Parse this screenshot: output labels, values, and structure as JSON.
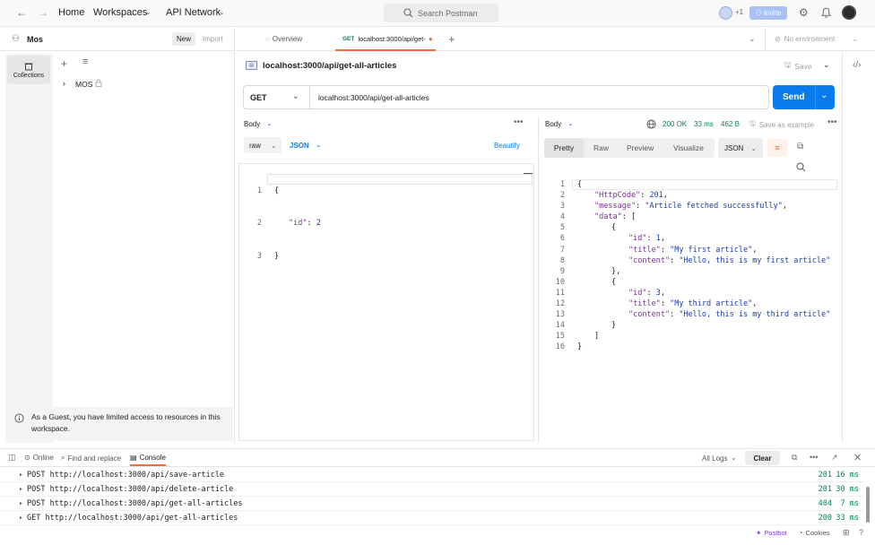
{
  "topbar": {
    "home": "Home",
    "workspaces": "Workspaces",
    "api_network": "API Network",
    "search_placeholder": "Search Postman",
    "plus_count": "+1",
    "invite": "Invite"
  },
  "sidebar": {
    "workspace": "Mos",
    "new": "New",
    "import": "Import",
    "collections": "Collections",
    "collection_name": "MOS",
    "guest_note": "As a Guest, you have limited access to resources in this workspace."
  },
  "tabs": {
    "overview": "Overview",
    "active_method": "GET",
    "active_label": "localhost:3000/api/get-",
    "environment": "No environment"
  },
  "request": {
    "title": "localhost:3000/api/get-all-articles",
    "save": "Save",
    "method": "GET",
    "url": "localhost:3000/api/get-all-articles",
    "send": "Send",
    "body_label": "Body",
    "raw": "raw",
    "json": "JSON",
    "beautify": "Beautify",
    "body_lines": [
      {
        "n": "1",
        "text": "{"
      },
      {
        "n": "2",
        "key": "\"id\"",
        "value": "2"
      },
      {
        "n": "3",
        "text": "}"
      }
    ]
  },
  "response": {
    "body_label": "Body",
    "status": "200 OK",
    "time": "33 ms",
    "size": "462 B",
    "save_example": "Save as example",
    "tabs": [
      "Pretty",
      "Raw",
      "Preview",
      "Visualize"
    ],
    "format": "JSON",
    "lines": [
      {
        "n": "1",
        "indent": 0,
        "p": "{"
      },
      {
        "n": "2",
        "indent": 1,
        "k": "\"HttpCode\"",
        "p": ": ",
        "v": "201",
        "e": ","
      },
      {
        "n": "3",
        "indent": 1,
        "k": "\"message\"",
        "p": ": ",
        "v": "\"Article fetched successfully\"",
        "e": ","
      },
      {
        "n": "4",
        "indent": 1,
        "k": "\"data\"",
        "p": ": ["
      },
      {
        "n": "5",
        "indent": 2,
        "p": "{"
      },
      {
        "n": "6",
        "indent": 3,
        "k": "\"id\"",
        "p": ": ",
        "v": "1",
        "e": ","
      },
      {
        "n": "7",
        "indent": 3,
        "k": "\"title\"",
        "p": ": ",
        "v": "\"My first article\"",
        "e": ","
      },
      {
        "n": "8",
        "indent": 3,
        "k": "\"content\"",
        "p": ": ",
        "v": "\"Hello, this is my first article\""
      },
      {
        "n": "9",
        "indent": 2,
        "p": "},"
      },
      {
        "n": "10",
        "indent": 2,
        "p": "{"
      },
      {
        "n": "11",
        "indent": 3,
        "k": "\"id\"",
        "p": ": ",
        "v": "3",
        "e": ","
      },
      {
        "n": "12",
        "indent": 3,
        "k": "\"title\"",
        "p": ": ",
        "v": "\"My third article\"",
        "e": ","
      },
      {
        "n": "13",
        "indent": 3,
        "k": "\"content\"",
        "p": ": ",
        "v": "\"Hello, this is my third article\""
      },
      {
        "n": "14",
        "indent": 2,
        "p": "}"
      },
      {
        "n": "15",
        "indent": 1,
        "p": "]"
      },
      {
        "n": "16",
        "indent": 0,
        "p": "}"
      }
    ]
  },
  "console": {
    "online": "Online",
    "find_replace": "Find and replace",
    "console": "Console",
    "all_logs": "All Logs",
    "clear": "Clear",
    "logs": [
      {
        "text": "POST http://localhost:3000/api/save-article",
        "status": "201",
        "ms": "16 ms"
      },
      {
        "text": "POST http://localhost:3000/api/delete-article",
        "status": "201",
        "ms": "30 ms"
      },
      {
        "text": "POST http://localhost:3000/api/get-all-articles",
        "status": "404",
        "ms": "7 ms"
      },
      {
        "text": "GET http://localhost:3000/api/get-all-articles",
        "status": "200",
        "ms": "33 ms"
      }
    ],
    "postbot": "Postbot",
    "cookies": "Cookies"
  }
}
